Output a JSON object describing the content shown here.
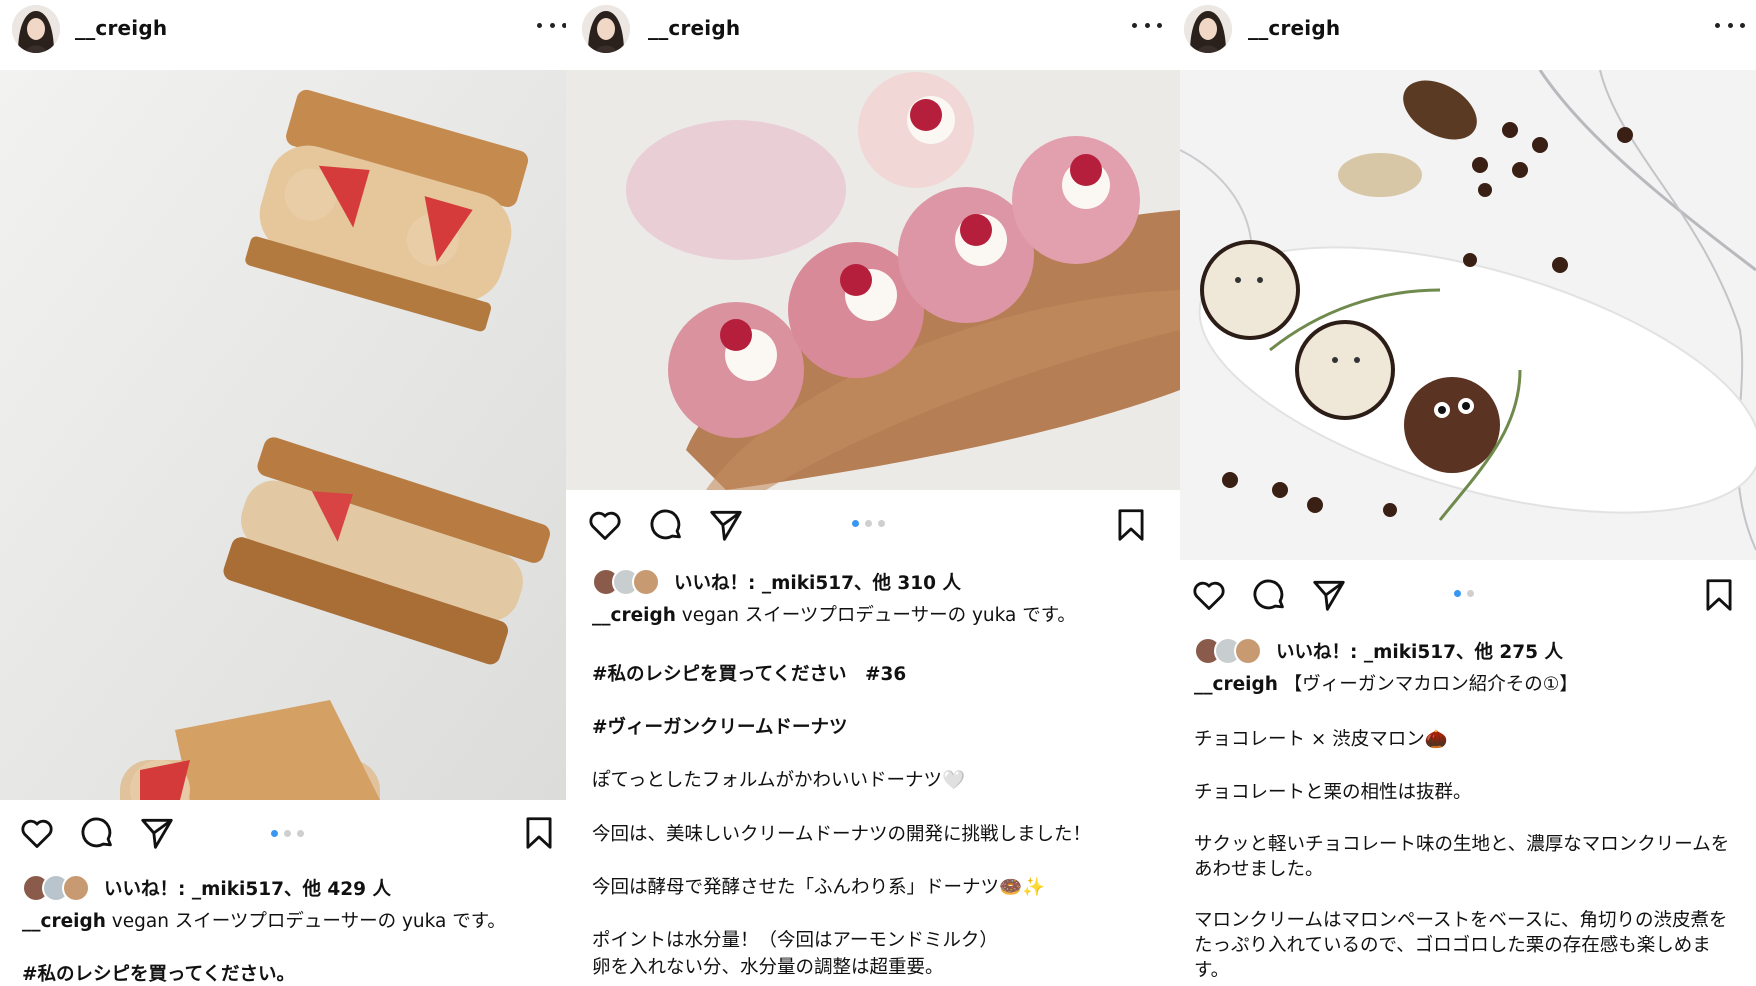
{
  "posts": [
    {
      "username": "__creigh",
      "likes_text": "いいね！: _miki517、他 429 人",
      "caption_user": "__creigh",
      "caption_text": " vegan スイーツプロデューサーの yuka です。",
      "lines": [
        "#私のレシピを買ってください。"
      ],
      "carousel": {
        "count": 3,
        "active": 1
      }
    },
    {
      "username": "__creigh",
      "likes_text": "いいね！: _miki517、他 310 人",
      "caption_user": "__creigh",
      "caption_text": " vegan スイーツプロデューサーの yuka です。",
      "lines": [
        "#私のレシピを買ってください　#36",
        "#ヴィーガンクリームドーナツ",
        "ぽてっとしたフォルムがかわいいドーナツ🤍",
        "今回は、美味しいクリームドーナツの開発に挑戦しました！",
        "今回は酵母で発酵させた「ふんわり系」ドーナツ🍩✨",
        "ポイントは水分量！（今回はアーモンドミルク）",
        "卵を入れない分、水分量の調整は超重要。"
      ],
      "carousel": {
        "count": 3,
        "active": 1
      }
    },
    {
      "username": "__creigh",
      "likes_text": "いいね！: _miki517、他 275 人",
      "caption_user": "__creigh",
      "caption_text": " 【ヴィーガンマカロン紹介その①】",
      "lines": [
        "チョコレート × 渋皮マロン🌰",
        "チョコレートと栗の相性は抜群。",
        "サクッと軽いチョコレート味の生地と、濃厚なマロンクリームを",
        "あわせました。",
        "マロンクリームはマロンペーストをベースに、角切りの渋皮煮を",
        "たっぷり入れているので、ゴロゴロした栗の存在感も楽しめま",
        "す。"
      ],
      "carousel": {
        "count": 2,
        "active": 1
      }
    }
  ],
  "icons": [
    "avatar",
    "more-icon",
    "heart-icon",
    "comment-icon",
    "share-icon",
    "bookmark-icon"
  ],
  "colors": {
    "hashtag": "#1b4f86",
    "carousel_active": "#3897f0",
    "carousel_inactive": "#cfcfcf"
  }
}
